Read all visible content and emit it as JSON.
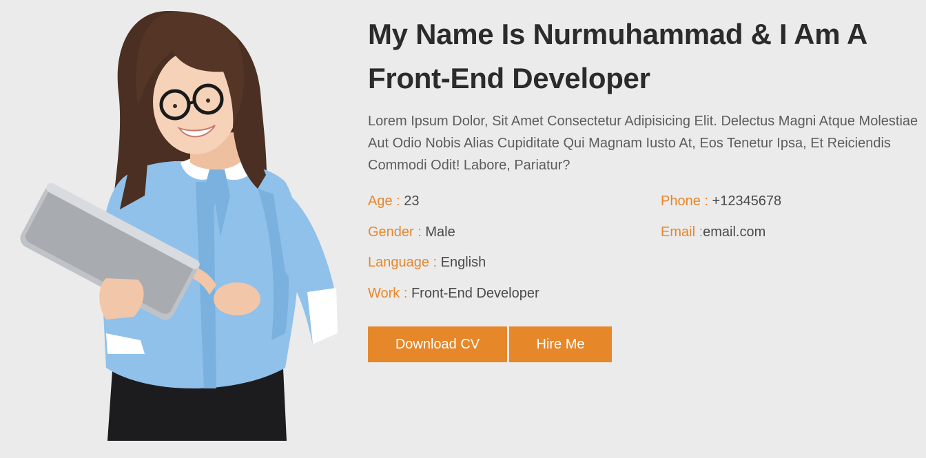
{
  "hero": {
    "heading_line1": "My Name Is Nurmuhammad & I Am A",
    "heading_line2": "Front-End Developer",
    "intro": "Lorem Ipsum Dolor, Sit Amet Consectetur Adipisicing Elit. Delectus Magni Atque Molestiae Aut Odio Nobis Alias Cupiditate Qui Magnam Iusto At, Eos Tenetur Ipsa, Et Reiciendis Commodi Odit! Labore, Pariatur?",
    "info": {
      "age_label": "Age : ",
      "age_value": "23",
      "gender_label": "Gender : ",
      "gender_value": "Male",
      "language_label": "Language : ",
      "language_value": "English",
      "work_label": "Work : ",
      "work_value": "Front-End Developer",
      "phone_label": "Phone : ",
      "phone_value": "+12345678",
      "email_label": "Email :",
      "email_value": "email.com"
    },
    "buttons": {
      "download_cv": "Download CV",
      "hire_me": "Hire Me"
    }
  },
  "colors": {
    "accent": "#e6872a",
    "background": "#ebebeb",
    "heading": "#2b2b2b",
    "body_text": "#5c5c5c"
  }
}
